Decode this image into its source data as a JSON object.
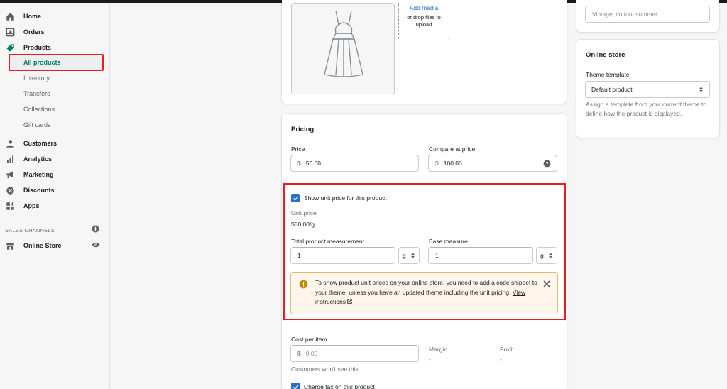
{
  "sidebar": {
    "items": [
      {
        "label": "Home",
        "icon": "home-icon"
      },
      {
        "label": "Orders",
        "icon": "orders-icon"
      },
      {
        "label": "Products",
        "icon": "tag-icon"
      },
      {
        "label": "Customers",
        "icon": "customer-icon"
      },
      {
        "label": "Analytics",
        "icon": "bar-chart-icon"
      },
      {
        "label": "Marketing",
        "icon": "megaphone-icon"
      },
      {
        "label": "Discounts",
        "icon": "discount-icon"
      },
      {
        "label": "Apps",
        "icon": "apps-icon"
      }
    ],
    "product_sub": [
      "All products",
      "Inventory",
      "Transfers",
      "Collections",
      "Gift cards"
    ],
    "sales_channels_label": "SALES CHANNELS",
    "online_store_label": "Online Store"
  },
  "media": {
    "add_media": "Add media",
    "drop_text": "or drop files to upload"
  },
  "pricing": {
    "title": "Pricing",
    "price_label": "Price",
    "price_prefix": "$",
    "price_value": "50.00",
    "compare_label": "Compare at price",
    "compare_prefix": "$",
    "compare_value": "100.00",
    "show_unit_label": "Show unit price for this product",
    "unit_price_label": "Unit price",
    "unit_price_value": "$50.00/g",
    "total_measure_label": "Total product measurement",
    "total_measure_value": "1",
    "total_measure_unit": "g",
    "base_measure_label": "Base measure",
    "base_measure_value": "1",
    "base_measure_unit": "g",
    "banner_text": "To show product unit prices on your online store, you need to add a code snippet to your theme, unless you have an updated theme including the unit pricing.",
    "banner_link": "View instructions",
    "cost_label": "Cost per item",
    "cost_prefix": "$",
    "cost_placeholder": "0.00",
    "cost_help": "Customers won't see this",
    "margin_label": "Margin",
    "margin_value": "-",
    "profit_label": "Profit",
    "profit_value": "-",
    "charge_tax_label": "Charge tax on this product"
  },
  "right": {
    "tags_placeholder": "Vintage, cotton, summer",
    "online_store_title": "Online store",
    "theme_template_label": "Theme template",
    "theme_template_value": "Default product",
    "theme_help": "Assign a template from your current theme to define how the product is displayed."
  },
  "colors": {
    "accent_green": "#008060",
    "highlight_red": "#e41e26",
    "link_blue": "#2c6ecb",
    "checkbox_blue": "#2c6ecb",
    "warning_bg": "#fff5ea"
  }
}
